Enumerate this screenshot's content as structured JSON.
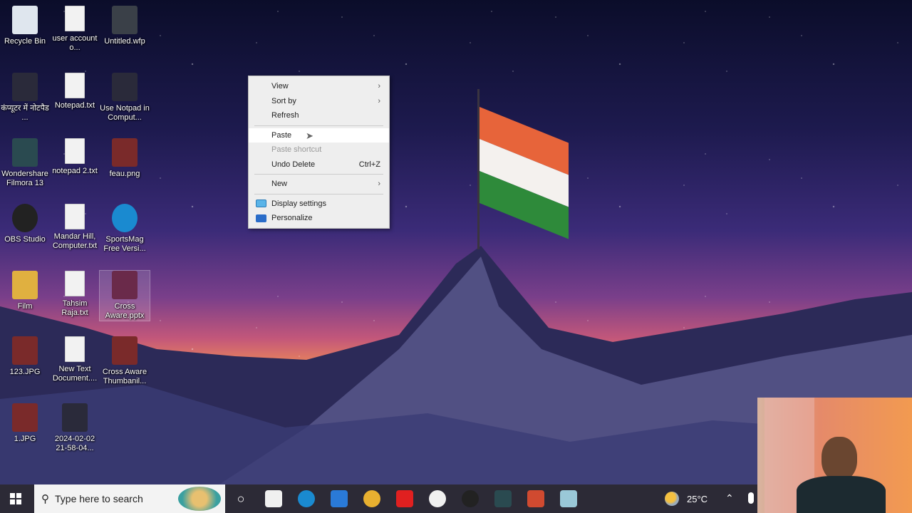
{
  "desktop": {
    "icons": [
      {
        "label": "Recycle Bin",
        "type": "recycle-bin"
      },
      {
        "label": "user account o...",
        "type": "text-file"
      },
      {
        "label": "Untitled.wfp",
        "type": "filmora-project"
      },
      {
        "label": "कंप्यूटर में नोटपैड ...",
        "type": "video"
      },
      {
        "label": "Notepad.txt",
        "type": "text-file"
      },
      {
        "label": "Use Notpad in Comput...",
        "type": "video"
      },
      {
        "label": "Wondershare Filmora 13",
        "type": "filmora-app"
      },
      {
        "label": "notepad 2.txt",
        "type": "text-file"
      },
      {
        "label": "feau.png",
        "type": "image"
      },
      {
        "label": "OBS Studio",
        "type": "obs-app"
      },
      {
        "label": "Mandar Hill, Computer.txt",
        "type": "text-file"
      },
      {
        "label": "SportsMag Free Versi...",
        "type": "edge-app"
      },
      {
        "label": "Film",
        "type": "folder"
      },
      {
        "label": "Tahsim Raja.txt",
        "type": "text-file"
      },
      {
        "label": "Cross Aware.pptx",
        "type": "powerpoint"
      },
      {
        "label": "123.JPG",
        "type": "image"
      },
      {
        "label": "New Text Document....",
        "type": "text-file"
      },
      {
        "label": "Cross Aware Thumbanil...",
        "type": "image"
      },
      {
        "label": "1.JPG",
        "type": "image"
      },
      {
        "label": "2024-02-02 21-58-04...",
        "type": "video"
      }
    ]
  },
  "context_menu": {
    "items": [
      {
        "label": "View",
        "submenu": true
      },
      {
        "label": "Sort by",
        "submenu": true
      },
      {
        "label": "Refresh"
      },
      {
        "label": "Paste",
        "hovered": true
      },
      {
        "label": "Paste shortcut",
        "disabled": true
      },
      {
        "label": "Undo Delete",
        "shortcut": "Ctrl+Z"
      },
      {
        "label": "New",
        "submenu": true
      },
      {
        "label": "Display settings",
        "icon": "display-icon"
      },
      {
        "label": "Personalize",
        "icon": "personalize-icon"
      }
    ]
  },
  "taskbar": {
    "search_placeholder": "Type here to search",
    "weather": "25°C",
    "apps": [
      "task-view",
      "microsoft-store",
      "edge",
      "mail",
      "chrome",
      "youtube",
      "whatsapp",
      "obs-studio",
      "filmora",
      "powerpoint",
      "notepad"
    ]
  },
  "colors": {
    "taskbar": "#2c2a36",
    "menu": "#eeeeee"
  }
}
